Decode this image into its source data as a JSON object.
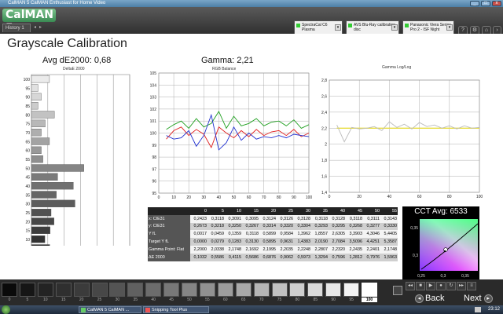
{
  "window": {
    "title": "CalMAN 5 CalMAN Enthusiast for Home Video",
    "min": "_",
    "max": "□",
    "close": "x"
  },
  "toolbar": {
    "logo": "CalMAN 5",
    "tab": "History 1",
    "dropdowns": [
      {
        "line1": "SpectraCal C6",
        "line2": "Plasma"
      },
      {
        "line1": "AVS Blu-Ray calibration disc",
        "line2": ""
      },
      {
        "line1": "Panasonic Viera Series",
        "line2": "Pro 2 - ISF Night"
      }
    ]
  },
  "page": {
    "title": "Grayscale Calibration"
  },
  "charts": {
    "de": {
      "label": "Avg dE2000: 0,68",
      "sub": "DeltaE 2000"
    },
    "rgb": {
      "label": "Gamma: 2,21",
      "sub": "RGB Balance"
    },
    "gamma": {
      "sub": "Gamma Log/Log"
    },
    "cct": {
      "label": "CCT Avg: 6533"
    }
  },
  "chart_data": [
    {
      "type": "bar",
      "title": "DeltaE 2000",
      "categories": [
        "0",
        "5",
        "10",
        "15",
        "20",
        "25",
        "30",
        "35",
        "40",
        "45",
        "50",
        "55",
        "60",
        "65",
        "70",
        "75",
        "80",
        "85",
        "90",
        "95",
        "100"
      ],
      "values": [
        0.1,
        0.56,
        0.41,
        0.57,
        0.69,
        0.6,
        1.33,
        0.76,
        1.28,
        0.8,
        1.6,
        0.35,
        0.3,
        0.55,
        0.3,
        0.42,
        0.7,
        0.2,
        0.3,
        0.2,
        0.55
      ],
      "xticks": [
        "0",
        "0,5",
        "1",
        "1,5",
        "2",
        "2,5",
        "3"
      ],
      "xlim": [
        0,
        3
      ]
    },
    {
      "type": "line",
      "title": "RGB Balance",
      "x": [
        5,
        10,
        15,
        20,
        25,
        30,
        35,
        40,
        45,
        50,
        55,
        60,
        65,
        70,
        75,
        80,
        85,
        90,
        95,
        100
      ],
      "series": [
        {
          "color": "#e02020",
          "values": [
            99.5,
            100.2,
            100.5,
            99.8,
            100.3,
            99.9,
            98.8,
            100.5,
            100,
            99.6,
            100.2,
            99.7,
            100.3,
            99.8,
            100.1,
            100.2,
            99.8,
            100.3,
            99.7,
            100.0
          ]
        },
        {
          "color": "#20a020",
          "values": [
            100.3,
            100.7,
            101,
            100.4,
            101.2,
            100.5,
            100.8,
            101.8,
            100.4,
            101.4,
            100.6,
            100.8,
            101.2,
            100.6,
            100.9,
            101,
            100.6,
            101.1,
            100.4,
            100.7
          ]
        },
        {
          "color": "#2030d0",
          "values": [
            99.8,
            99.5,
            99.6,
            100.2,
            98.9,
            99.8,
            101.5,
            98.6,
            99.2,
            100.5,
            99.4,
            100,
            99.5,
            99.7,
            99.6,
            99.8,
            99.6,
            99.9,
            99.8,
            99.7
          ]
        }
      ],
      "yticks": [
        "95",
        "96",
        "97",
        "98",
        "99",
        "100",
        "101",
        "102",
        "103",
        "104",
        "105"
      ],
      "xticks": [
        "0",
        "10",
        "20",
        "30",
        "40",
        "50",
        "60",
        "70",
        "80",
        "90",
        "100"
      ],
      "ylim": [
        95,
        105
      ]
    },
    {
      "type": "line",
      "title": "Gamma Log/Log",
      "x": [
        5,
        10,
        15,
        20,
        25,
        30,
        35,
        40,
        45,
        50,
        55,
        60,
        65,
        70,
        75,
        80,
        85,
        90,
        95,
        100
      ],
      "series": [
        {
          "color": "#e8dd40",
          "values": [
            2.2,
            2.2,
            2.2,
            2.2,
            2.2,
            2.2,
            2.2,
            2.2,
            2.2,
            2.2,
            2.2,
            2.2,
            2.2,
            2.2,
            2.2,
            2.2,
            2.2,
            2.2,
            2.2,
            2.2
          ]
        },
        {
          "color": "#bbbbbb",
          "values": [
            2.24,
            2.03,
            2.21,
            2.19,
            2.2,
            2.22,
            2.17,
            2.28,
            2.21,
            2.25,
            2.19,
            2.27,
            2.22,
            2.24,
            2.2,
            2.23,
            2.19,
            2.23,
            2.2,
            2.21
          ]
        }
      ],
      "yticks": [
        "1,4",
        "1,6",
        "1,8",
        "2",
        "2,2",
        "2,4",
        "2,6",
        "2,8"
      ],
      "xticks": [
        "0",
        "20",
        "40",
        "60",
        "80",
        "100"
      ],
      "ylim": [
        1.4,
        2.8
      ]
    },
    {
      "type": "scatter",
      "title": "CCT Avg: 6533",
      "xticks": [
        "0,25",
        "0,3",
        "0,35"
      ],
      "yticks": [
        "0,3",
        "0,35"
      ]
    }
  ],
  "table": {
    "header": [
      "",
      "0",
      "5",
      "10",
      "15",
      "20",
      "25",
      "30",
      "35",
      "40",
      "45",
      "50",
      "55"
    ],
    "rows": [
      [
        "x: CIE31",
        "0,2423",
        "0,3118",
        "0,3091",
        "0,3095",
        "0,3124",
        "0,3126",
        "0,3128",
        "0,3118",
        "0,3128",
        "0,3118",
        "0,3111",
        "0,3143"
      ],
      [
        "y: CIE31",
        "0,2673",
        "0,3218",
        "0,3250",
        "0,3267",
        "0,3314",
        "0,3320",
        "0,3304",
        "0,3293",
        "0,3295",
        "0,3268",
        "0,3277",
        "0,3330"
      ],
      [
        "Y fL",
        "0,0017",
        "0,0459",
        "0,1359",
        "0,3118",
        "0,5899",
        "0,9584",
        "1,3962",
        "1,8557",
        "2,6305",
        "3,3903",
        "4,3046",
        "5,4405"
      ],
      [
        "Target Y fL",
        "0,0000",
        "0,0279",
        "0,1283",
        "0,3130",
        "0,5895",
        "0,9631",
        "1,4383",
        "2,0190",
        "2,7084",
        "3,5096",
        "4,4251",
        "5,3587"
      ],
      [
        "Gamma Point: Flat",
        "2,2000",
        "2,0338",
        "2,1748",
        "2,1692",
        "2,1995",
        "2,2035",
        "2,2248",
        "2,2807",
        "2,2320",
        "2,2435",
        "2,2401",
        "2,1748"
      ],
      [
        "ΔE 2000",
        "0,1032",
        "0,5586",
        "0,4115",
        "0,5686",
        "0,6876",
        "0,9062",
        "0,5973",
        "1,3294",
        "0,7596",
        "1,2812",
        "0,7976",
        "1,5963"
      ]
    ]
  },
  "swatches": {
    "labels": [
      "0",
      "5",
      "10",
      "15",
      "20",
      "25",
      "30",
      "35",
      "40",
      "45",
      "50",
      "55",
      "60",
      "65",
      "70",
      "75",
      "80",
      "85",
      "90",
      "95",
      "100"
    ],
    "selected": "100"
  },
  "nav": {
    "back": "Back",
    "next": "Next"
  },
  "taskbar": {
    "tasks": [
      "CalMAN 5 CalMAN ...",
      "Snipping Tool Plus"
    ],
    "clock": "23:12"
  }
}
